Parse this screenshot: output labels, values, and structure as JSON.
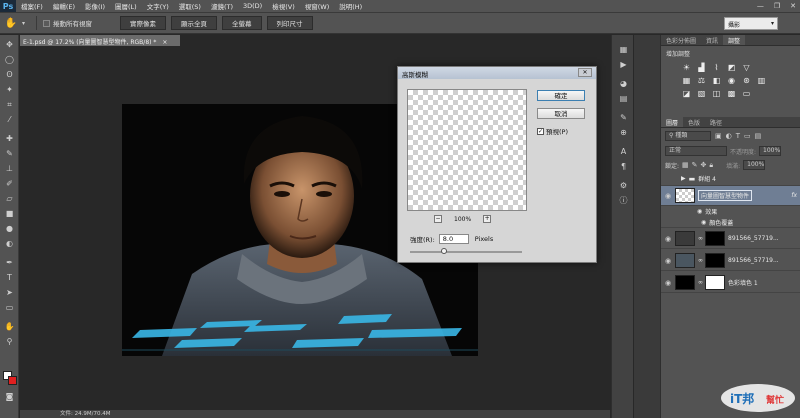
{
  "menubar": {
    "logo": "Ps",
    "items": [
      "檔案(F)",
      "編輯(E)",
      "影像(I)",
      "圖層(L)",
      "文字(Y)",
      "選取(S)",
      "濾鏡(T)",
      "3D(D)",
      "檢視(V)",
      "視窗(W)",
      "說明(H)"
    ],
    "window_controls": [
      "—",
      "❐",
      "✕"
    ]
  },
  "optionsbar": {
    "scroll_all_label": "捲動所有視窗",
    "buttons": [
      "實際像素",
      "顯示全頁",
      "全螢幕",
      "列印尺寸"
    ],
    "workspace": "攝影"
  },
  "document": {
    "tab_title": "E-1.psd @ 17.2% (向量圖智慧型物件, RGB/8) *",
    "status": "文件: 24.9M/70.4M"
  },
  "dialog": {
    "title": "高斯模糊",
    "ok_label": "確定",
    "cancel_label": "取消",
    "preview_label": "預視(P)",
    "zoom_value": "100%",
    "radius_label": "強度(R):",
    "radius_value": "8.0",
    "radius_unit": "Pixels",
    "radius_fraction": 0.3
  },
  "adjustments_panel": {
    "tabs": [
      "色彩分佈圖",
      "資訊",
      "調整"
    ],
    "active_tab": 2,
    "title": "增加調整"
  },
  "layers_panel": {
    "tabs": [
      "圖層",
      "色版",
      "路徑"
    ],
    "filter_label": "種類",
    "blend_mode": "正常",
    "opacity_label": "不透明度:",
    "opacity_value": "100%",
    "lock_label": "鎖定:",
    "fill_label": "填滿:",
    "fill_value": "100%",
    "layers": [
      {
        "name": "群組 4",
        "kind": "group"
      },
      {
        "name": "向量圖智慧型物件",
        "kind": "smart",
        "fx": "fx"
      },
      {
        "name": "效果",
        "kind": "effect"
      },
      {
        "name": "顏色覆蓋",
        "kind": "effect"
      },
      {
        "name": "891566_57719...",
        "kind": "layer"
      },
      {
        "name": "891566_57719...",
        "kind": "layer"
      },
      {
        "name": "色彩填色 1",
        "kind": "fill"
      }
    ]
  },
  "watermark": {
    "text1": "iT邦",
    "text2": "幫忙"
  }
}
